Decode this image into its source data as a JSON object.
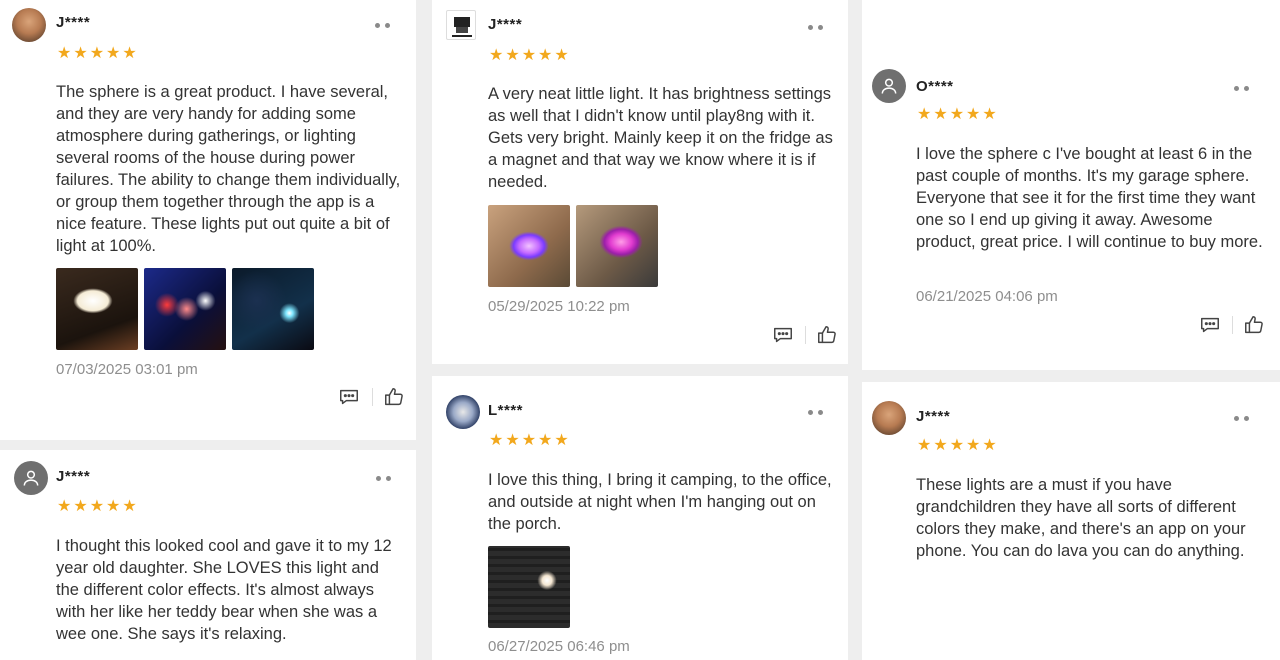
{
  "reviews": [
    {
      "name": "J****",
      "stars": "★★★★★",
      "rating": 5,
      "text": "The sphere is a great product. I have several, and they are very handy for adding some atmosphere during gatherings, or lighting several rooms of the house during power failures. The ability to change them individually, or group them together through the app is a nice feature. These lights put out quite a bit of light at 100%.",
      "date": "07/03/2025 03:01 pm"
    },
    {
      "name": "J****",
      "stars": "★★★★★",
      "rating": 5,
      "text": "A very neat little light. It has brightness settings as well that I didn't know until play8ng with it. Gets very bright. Mainly keep it on the fridge as a magnet and that way we know where it is if needed.",
      "date": "05/29/2025 10:22 pm"
    },
    {
      "name": "O****",
      "stars": "★★★★★",
      "rating": 5,
      "text": "I love the sphere c I've bought at least 6 in the past couple of months. It's my garage sphere. Everyone that see it for the first time they want one so I end up giving it away. Awesome product, great price. I will continue to buy more.",
      "date": "06/21/2025 04:06 pm"
    },
    {
      "name": "J****",
      "stars": "★★★★★",
      "rating": 5,
      "text": "I thought this looked cool and gave it to my 12 year old daughter. She LOVES this light and the different color effects. It's almost always with her like her teddy bear when she was a wee one. She says it's relaxing.",
      "date": ""
    },
    {
      "name": "L****",
      "stars": "★★★★★",
      "rating": 5,
      "text": "I love this thing, I bring it camping, to the office, and outside at night when I'm hanging out on the porch.",
      "date": "06/27/2025 06:46 pm"
    },
    {
      "name": "J****",
      "stars": "★★★★★",
      "rating": 5,
      "text": "These lights are a must if you have grandchildren they have all sorts of different colors they make, and there's an app on your phone. You can do lava you can do anything.",
      "date": ""
    }
  ],
  "icons": {
    "more": "more-dots-icon",
    "comment": "comment-icon",
    "like": "thumbs-up-icon",
    "user": "user-icon"
  },
  "colors": {
    "star": "#f2a81d",
    "date": "#8e8e8e",
    "background": "#eeeeee"
  }
}
